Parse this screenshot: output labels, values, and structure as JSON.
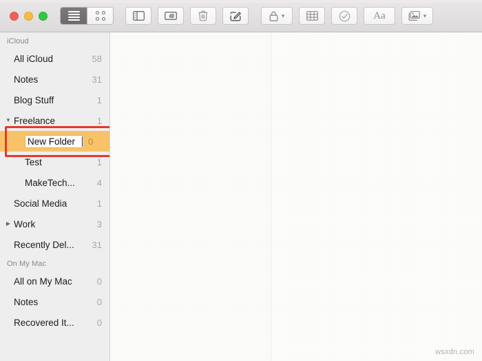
{
  "window": {
    "traffic_lights": [
      "close",
      "minimize",
      "zoom"
    ]
  },
  "toolbar": {
    "view_list_label": "list-view",
    "view_grid_label": "grid-view",
    "sidebar_toggle_label": "sidebar-toggle",
    "attachments_label": "attachments-browser",
    "delete_label": "delete-note",
    "compose_label": "new-note",
    "lock_label": "lock-note",
    "table_label": "insert-table",
    "checklist_label": "checklist",
    "format_label": "Aa",
    "media_label": "insert-media"
  },
  "sidebar": {
    "sections": [
      {
        "header": "iCloud",
        "items": [
          {
            "label": "All iCloud",
            "count": "58",
            "indent": false,
            "disclosure": "none",
            "editing": false
          },
          {
            "label": "Notes",
            "count": "31",
            "indent": false,
            "disclosure": "none",
            "editing": false
          },
          {
            "label": "Blog Stuff",
            "count": "1",
            "indent": false,
            "disclosure": "none",
            "editing": false
          },
          {
            "label": "Freelance",
            "count": "1",
            "indent": false,
            "disclosure": "expanded",
            "editing": false
          },
          {
            "label": "New Folder",
            "count": "0",
            "indent": true,
            "disclosure": "none",
            "editing": true
          },
          {
            "label": "Test",
            "count": "1",
            "indent": true,
            "disclosure": "none",
            "editing": false
          },
          {
            "label": "MakeTech...",
            "count": "4",
            "indent": true,
            "disclosure": "none",
            "editing": false
          },
          {
            "label": "Social Media",
            "count": "1",
            "indent": false,
            "disclosure": "none",
            "editing": false
          },
          {
            "label": "Work",
            "count": "3",
            "indent": false,
            "disclosure": "collapsed",
            "editing": false
          },
          {
            "label": "Recently Del...",
            "count": "31",
            "indent": false,
            "disclosure": "none",
            "editing": false
          }
        ]
      },
      {
        "header": "On My Mac",
        "items": [
          {
            "label": "All on My Mac",
            "count": "0",
            "indent": false,
            "disclosure": "none",
            "editing": false
          },
          {
            "label": "Notes",
            "count": "0",
            "indent": false,
            "disclosure": "none",
            "editing": false
          },
          {
            "label": "Recovered It...",
            "count": "0",
            "indent": false,
            "disclosure": "none",
            "editing": false
          }
        ]
      }
    ]
  },
  "annotation": {
    "color": "#e8382a",
    "target": "New Folder"
  },
  "watermark": {
    "text": "wsxdn.com"
  }
}
